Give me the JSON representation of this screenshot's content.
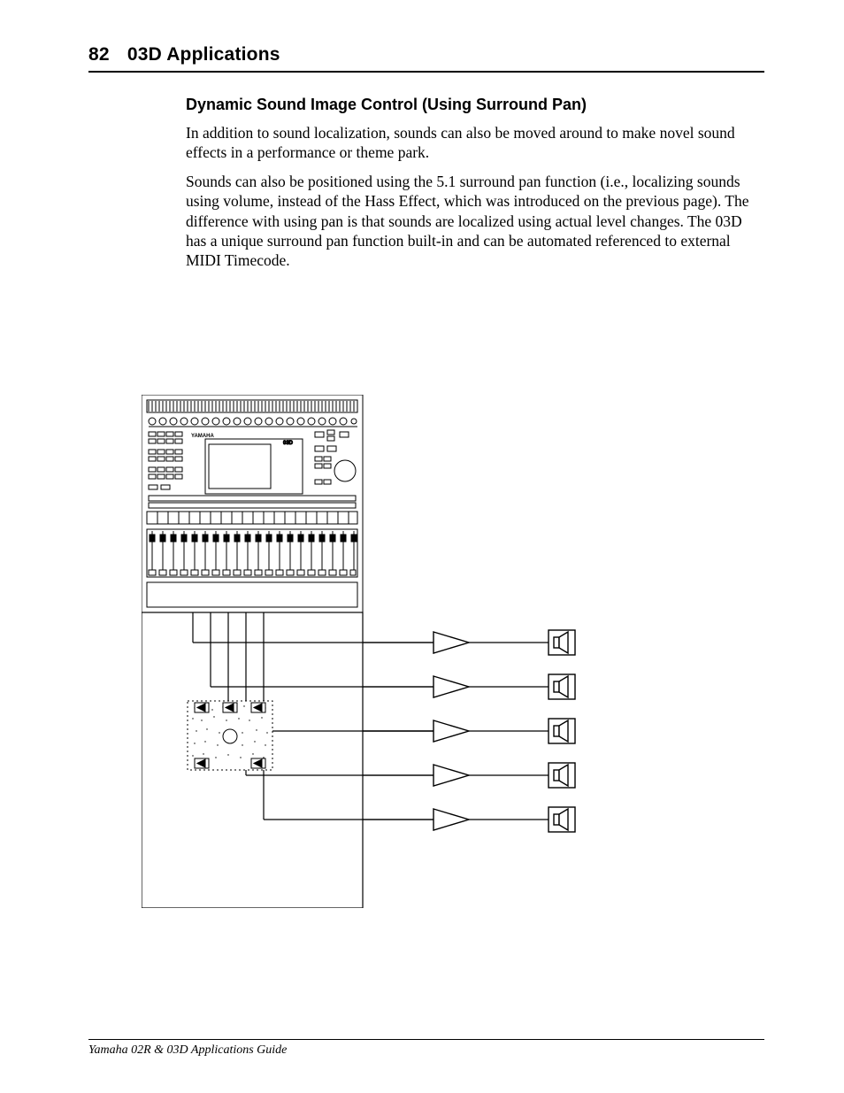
{
  "header": {
    "page_number": "82",
    "chapter_title": "03D Applications"
  },
  "section": {
    "title": "Dynamic Sound Image Control (Using Surround Pan)",
    "paragraphs": [
      "In addition to sound localization, sounds can also be moved around to make novel sound effects in a performance or theme park.",
      "Sounds can also be positioned using the 5.1 surround pan function (i.e., localizing sounds using volume, instead of the Hass Effect, which was introduced on the previous page). The difference with using pan is that sounds are localized using actual level changes. The 03D has a unique surround pan function built-in and can be automated referenced to external MIDI Timecode."
    ]
  },
  "figure": {
    "device_label": "YAMAHA",
    "screen_label": "03D",
    "icons": {
      "mixer": "mixing-console",
      "amp": "amplifier",
      "speaker": "loudspeaker",
      "room": "surround-room"
    }
  },
  "footer": {
    "text": "Yamaha 02R & 03D Applications Guide"
  }
}
